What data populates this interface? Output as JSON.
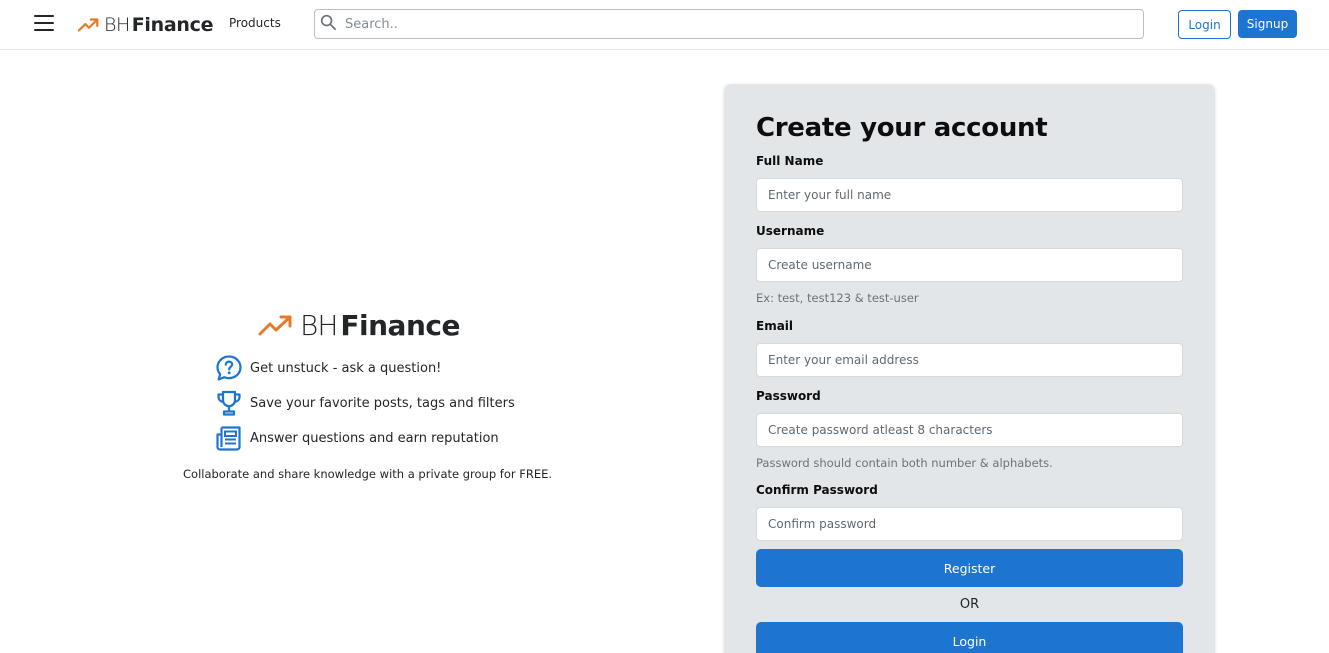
{
  "header": {
    "brand_light": "BH",
    "brand_bold": "Finance",
    "products_label": "Products",
    "search_placeholder": "Search..",
    "login_label": "Login",
    "signup_label": "Signup"
  },
  "promo": {
    "brand_light": "BH",
    "brand_bold": "Finance",
    "features": [
      {
        "icon": "question-bubble-icon",
        "text": "Get unstuck - ask a question!"
      },
      {
        "icon": "trophy-icon",
        "text": "Save your favorite posts, tags and filters"
      },
      {
        "icon": "newspaper-icon",
        "text": "Answer questions and earn reputation"
      }
    ],
    "tagline": "Collaborate and share knowledge with a private group for FREE."
  },
  "form": {
    "title": "Create your account",
    "full_name_label": "Full Name",
    "full_name_placeholder": "Enter your full name",
    "username_label": "Username",
    "username_placeholder": "Create username",
    "username_hint": "Ex: test, test123 & test-user",
    "email_label": "Email",
    "email_placeholder": "Enter your email address",
    "password_label": "Password",
    "password_placeholder": "Create password atleast 8 characters",
    "password_hint": "Password should contain both number & alphabets.",
    "confirm_label": "Confirm Password",
    "confirm_placeholder": "Confirm password",
    "register_label": "Register",
    "or_text": "OR",
    "login_label": "Login"
  },
  "colors": {
    "accent_blue": "#1d74d1",
    "brand_orange": "#e8782a",
    "card_bg": "#e3e6e8"
  }
}
